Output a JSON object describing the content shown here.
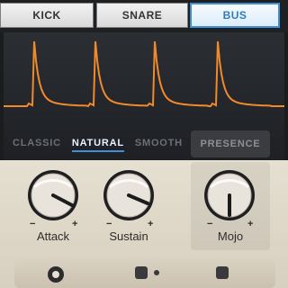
{
  "tabs": [
    {
      "label": "KICK",
      "active": false
    },
    {
      "label": "SNARE",
      "active": false
    },
    {
      "label": "BUS",
      "active": true
    }
  ],
  "modes": [
    {
      "label": "CLASSIC",
      "active": false
    },
    {
      "label": "NATURAL",
      "active": true
    },
    {
      "label": "SMOOTH",
      "active": false
    }
  ],
  "presence": {
    "label": "PRESENCE"
  },
  "knobs": [
    {
      "label": "Attack",
      "minus": "−",
      "plus": "+"
    },
    {
      "label": "Sustain",
      "minus": "−",
      "plus": "+"
    },
    {
      "label": "Mojo",
      "minus": "−",
      "plus": "+"
    }
  ],
  "bottom": {
    "left_icon": "power-icon",
    "middle_icon": "toggle-switch-icon",
    "right_icon": "toggle-switch-icon"
  },
  "colors": {
    "accent": "#3f8fd6",
    "waveform": "#f08a2a",
    "panel_light": "#e6e0d2"
  }
}
